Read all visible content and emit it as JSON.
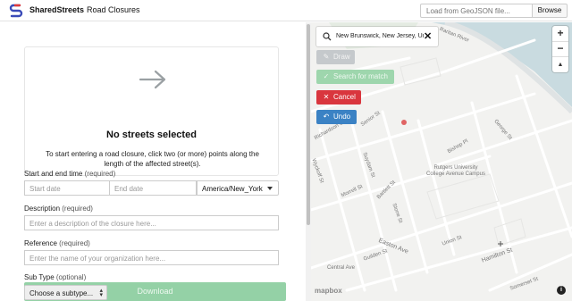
{
  "header": {
    "brand": "SharedStreets",
    "subtitle": "Road Closures",
    "geojson_placeholder": "Load from GeoJSON file...",
    "browse_label": "Browse"
  },
  "empty_state": {
    "icon": "arrow-right-icon",
    "title": "No streets selected",
    "description": "To start entering a road closure, click two (or more) points along the length of the affected street(s)."
  },
  "form": {
    "time": {
      "label": "Start and end time",
      "required": "(required)",
      "start_placeholder": "Start date",
      "end_placeholder": "End date",
      "timezone": "America/New_York"
    },
    "description": {
      "label": "Description",
      "required": "(required)",
      "placeholder": "Enter a description of the closure here..."
    },
    "reference": {
      "label": "Reference",
      "required": "(required)",
      "placeholder": "Enter the name of your organization here..."
    },
    "subtype": {
      "label": "Sub Type",
      "optional": "(optional)",
      "selected": "Choose a subtype..."
    },
    "download_label": "Download"
  },
  "map": {
    "search_value": "New Brunswick, New Jersey, Unit",
    "buttons": {
      "draw": "Draw",
      "search_for_match": "Search for match",
      "cancel": "Cancel",
      "undo": "Undo"
    },
    "zoom_in": "+",
    "zoom_out": "−",
    "compass": "▲",
    "attribution_logo": "mapbox",
    "info": "i",
    "street_labels": {
      "raritan_river": "Raritan River",
      "george_st": "George St",
      "senior_st": "Senior St",
      "richardson_st": "Richardson St",
      "bishop_pl": "Bishop Pl",
      "wyckoff_st": "Wyckoff St",
      "suydam_st": "Suydam St",
      "morrell_st": "Morrell St",
      "bartlett_st": "Bartlett St",
      "campus": "Rutgers University College Avenue Campus",
      "stone_st": "Stone St",
      "easton_ave": "Easton Ave",
      "union_st": "Union St",
      "hamilton_st": "Hamilton St",
      "guilden_st": "Guilden St",
      "central_ave": "Central Ave",
      "somerset_st": "Somerset St"
    },
    "colors": {
      "water": "#c9dbe0",
      "park": "#e4ebe2",
      "cancel": "#d9363e",
      "undo": "#3b82c4",
      "search_match": "#9ed6ad"
    }
  }
}
